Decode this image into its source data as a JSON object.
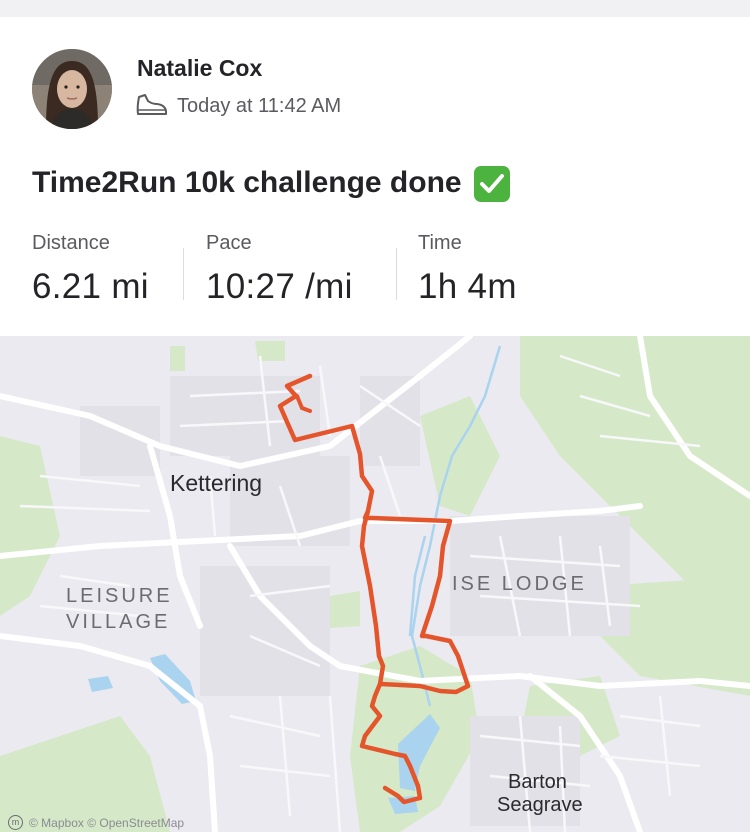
{
  "activity": {
    "author": "Natalie Cox",
    "timestamp": "Today at 11:42 AM",
    "activity_icon": "shoe-icon",
    "title": "Time2Run 10k challenge done",
    "title_emoji": "✅"
  },
  "stats": [
    {
      "label": "Distance",
      "value": "6.21 mi"
    },
    {
      "label": "Pace",
      "value": "10:27 /mi"
    },
    {
      "label": "Time",
      "value": "1h 4m"
    }
  ],
  "map": {
    "labels": {
      "town": "Kettering",
      "area1": "ISE LODGE",
      "area2_line1": "LEISURE",
      "area2_line2": "VILLAGE",
      "area3_line1": "Barton",
      "area3_line2": "Seagrave"
    },
    "attribution": "© Mapbox © OpenStreetMap",
    "route_color": "#e4552b",
    "water_color": "#a9d3ee",
    "park_color": "#cfe6c2"
  }
}
